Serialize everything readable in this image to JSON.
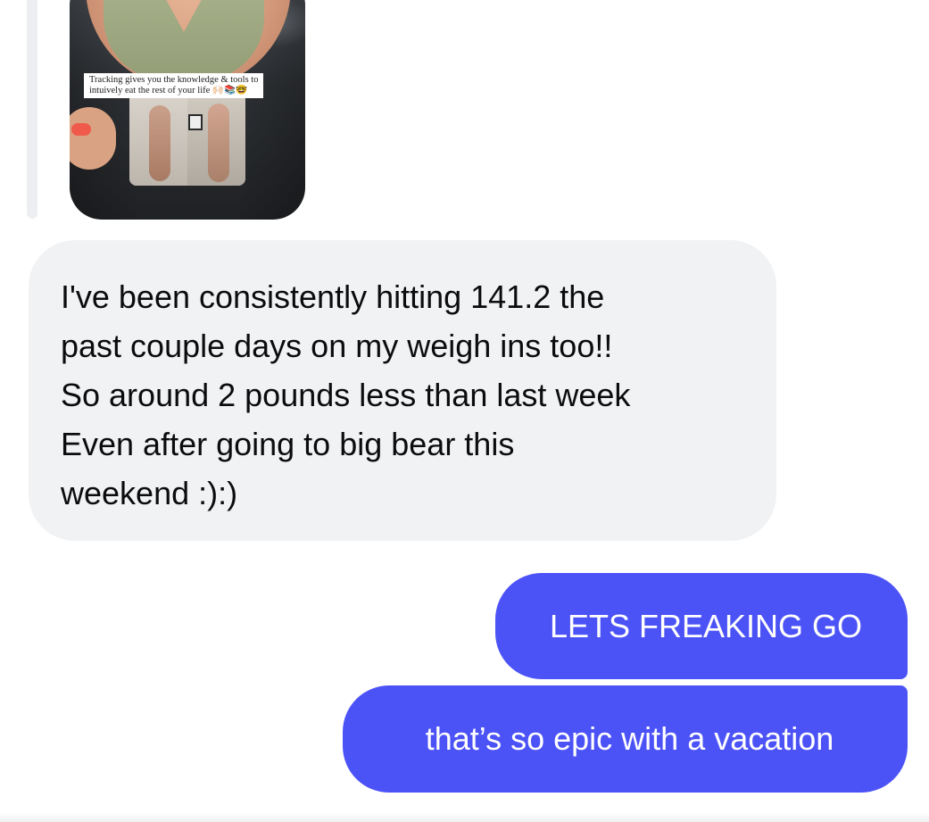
{
  "story": {
    "caption_line1": "Tracking gives you the knowledge & tools to",
    "caption_line2": "intuively eat the rest of your life 🙌🏻📚🤓"
  },
  "messages": {
    "incoming": {
      "lines": [
        "I've been consistently hitting 141.2 the",
        "past couple days on my weigh ins too!!",
        "So around 2 pounds less than last week",
        "Even after going to big bear this",
        "weekend :):)"
      ]
    },
    "outgoing": [
      {
        "text": "LETS FREAKING GO"
      },
      {
        "text": "that’s so epic with a vacation"
      }
    ]
  },
  "colors": {
    "incoming_bubble": "#f1f2f4",
    "outgoing_bubble": "#4c53f6",
    "reply_bar": "#eceef1"
  }
}
